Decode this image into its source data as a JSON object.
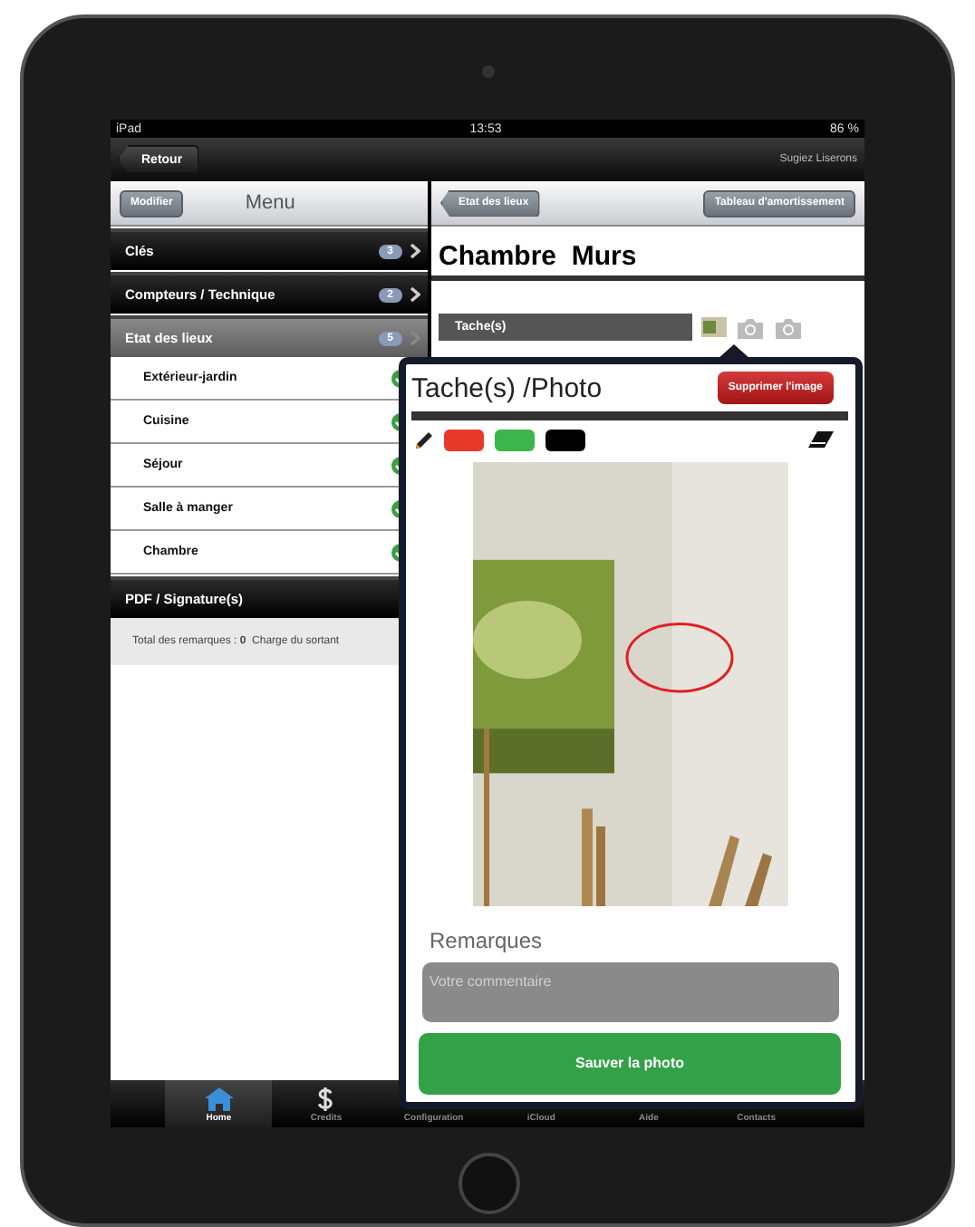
{
  "status_bar": {
    "device": "iPad",
    "time": "13:53",
    "battery": "86 %"
  },
  "nav_bar": {
    "back": "Retour",
    "user": "Sugiez Liserons"
  },
  "left_panel": {
    "edit": "Modifier",
    "title": "Menu",
    "sections": [
      {
        "label": "Clés",
        "count": "3",
        "selected": false
      },
      {
        "label": "Compteurs / Technique",
        "count": "2",
        "selected": false
      },
      {
        "label": "Etat des lieux",
        "count": "5",
        "selected": true,
        "children": [
          {
            "label": "Extérieur-jardin",
            "checked": true
          },
          {
            "label": "Cuisine",
            "checked": true
          },
          {
            "label": "Séjour",
            "checked": true
          },
          {
            "label": "Salle à manger",
            "checked": true
          },
          {
            "label": "Chambre",
            "checked": true
          }
        ]
      },
      {
        "label": "PDF / Signature(s)",
        "selected": false
      }
    ],
    "footer": "Total des remarques : **0**  Charge du sortant"
  },
  "right_panel": {
    "back": "Etat des lieux",
    "action": "Tableau d'amortissement",
    "title": "Chambre  Murs",
    "section": "Tache(s)"
  },
  "popover": {
    "title": "Tache(s) /Photo",
    "delete": "Supprimer l'image",
    "colors": [
      {
        "color": "#e8392b"
      },
      {
        "color": "#3cb54a"
      },
      {
        "color": "#000000"
      }
    ],
    "remarks_label": "Remarques",
    "comment_placeholder": "Votre commentaire",
    "save": "Sauver la photo"
  },
  "tab_bar": [
    {
      "label": "Home",
      "selected": true,
      "kind": "home"
    },
    {
      "label": "Credits",
      "selected": false,
      "kind": "dollar"
    },
    {
      "label": "Configuration",
      "selected": false,
      "kind": "hidden"
    },
    {
      "label": "iCloud",
      "selected": false,
      "kind": "hidden"
    },
    {
      "label": "Aide",
      "selected": false,
      "kind": "hidden"
    },
    {
      "label": "Contacts",
      "selected": false,
      "kind": "hidden"
    }
  ]
}
